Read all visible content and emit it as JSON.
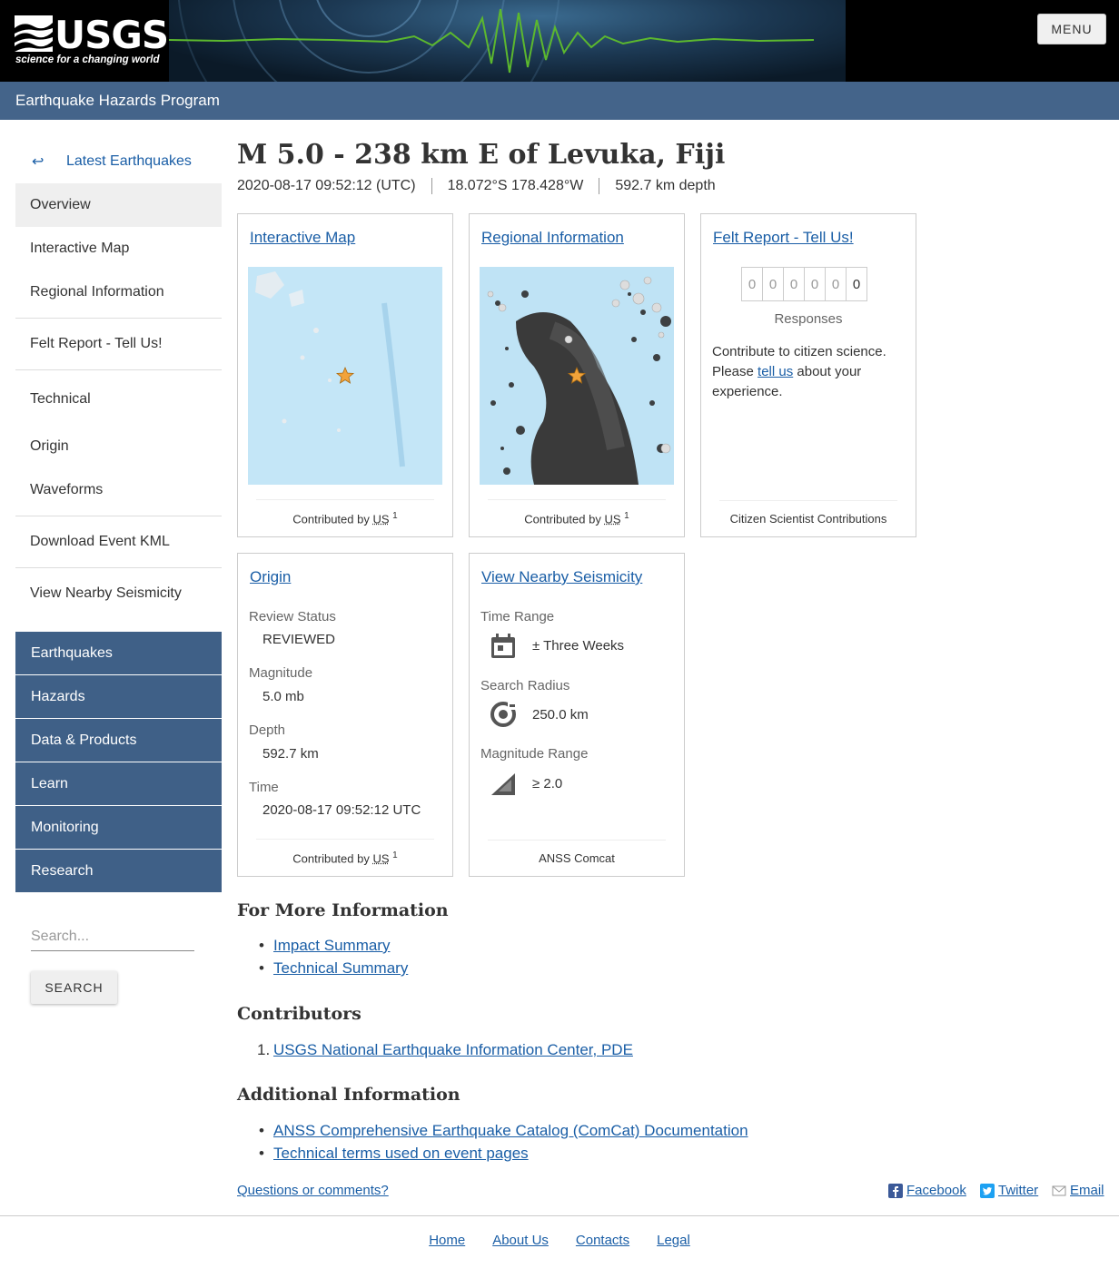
{
  "header": {
    "logo_text": "USGS",
    "logo_tagline": "science for a changing world",
    "menu_label": "MENU",
    "program": "Earthquake Hazards Program"
  },
  "sidebar": {
    "back_label": "Latest Earthquakes",
    "items": [
      "Overview",
      "Interactive Map",
      "Regional Information",
      "Felt Report - Tell Us!",
      "Technical",
      "Origin",
      "Waveforms",
      "Download Event KML",
      "View Nearby Seismicity"
    ],
    "active": "Overview",
    "nav": [
      "Earthquakes",
      "Hazards",
      "Data & Products",
      "Learn",
      "Monitoring",
      "Research"
    ],
    "search_placeholder": "Search...",
    "search_button": "SEARCH"
  },
  "event": {
    "title": "M 5.0 - 238 km E of Levuka, Fiji",
    "time": "2020-08-17 09:52:12 (UTC)",
    "location": "18.072°S 178.428°W",
    "depth": "592.7 km depth"
  },
  "cards": {
    "map": {
      "title": "Interactive Map",
      "foot": "Contributed by",
      "net": "US",
      "sup": "1"
    },
    "regional": {
      "title": "Regional Information",
      "foot": "Contributed by",
      "net": "US",
      "sup": "1"
    },
    "felt": {
      "title": "Felt Report - Tell Us!",
      "digits": [
        "0",
        "0",
        "0",
        "0",
        "0",
        "0"
      ],
      "responses": "Responses",
      "text_before": "Contribute to citizen science. Please ",
      "link": "tell us",
      "text_after": " about your experience.",
      "foot": "Citizen Scientist Contributions"
    },
    "origin": {
      "title": "Origin",
      "review_label": "Review Status",
      "review_value": "REVIEWED",
      "mag_label": "Magnitude",
      "mag_value": "5.0 mb",
      "depth_label": "Depth",
      "depth_value": "592.7 km",
      "time_label": "Time",
      "time_value": "2020-08-17 09:52:12 UTC",
      "foot": "Contributed by",
      "net": "US",
      "sup": "1"
    },
    "nearby": {
      "title": "View Nearby Seismicity",
      "range_label": "Time Range",
      "range_value": "± Three Weeks",
      "radius_label": "Search Radius",
      "radius_value": "250.0 km",
      "mag_label": "Magnitude Range",
      "mag_value": "≥ 2.0",
      "foot": "ANSS Comcat"
    }
  },
  "more_info": {
    "heading": "For More Information",
    "links": [
      "Impact Summary",
      "Technical Summary"
    ]
  },
  "contributors": {
    "heading": "Contributors",
    "links": [
      "USGS National Earthquake Information Center, PDE"
    ]
  },
  "additional": {
    "heading": "Additional Information",
    "links": [
      "ANSS Comprehensive Earthquake Catalog (ComCat) Documentation",
      "Technical terms used on event pages"
    ]
  },
  "questions": "Questions or comments?",
  "share": {
    "facebook": "Facebook",
    "twitter": "Twitter",
    "email": "Email"
  },
  "footer": [
    "Home",
    "About Us",
    "Contacts",
    "Legal"
  ],
  "colors": {
    "nav_blue": "#3f6087",
    "subheader": "#44648a",
    "link": "#1a5ea6",
    "seismo_green": "#5cb82e",
    "star": "#f2a33a"
  }
}
